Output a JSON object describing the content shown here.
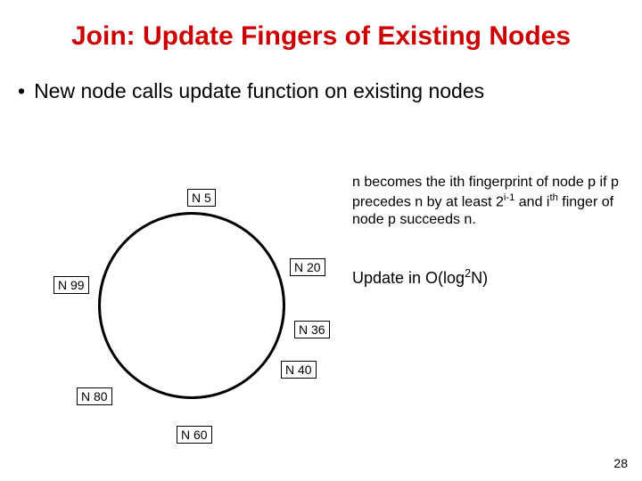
{
  "title": "Join: Update Fingers of Existing Nodes",
  "bullet": "New node calls update function on existing nodes",
  "nodes": {
    "n5": "N 5",
    "n20": "N 20",
    "n36": "N 36",
    "n40": "N 40",
    "n60": "N 60",
    "n80": "N 80",
    "n99": "N 99"
  },
  "note_html": "n becomes the ith fingerprint of node p if p precedes n by at least 2<sup>i-1</sup> and i<sup>th</sup> finger of node p succeeds n.",
  "complexity_html": "Update in O(log<sup>2</sup>N)",
  "page": "28"
}
